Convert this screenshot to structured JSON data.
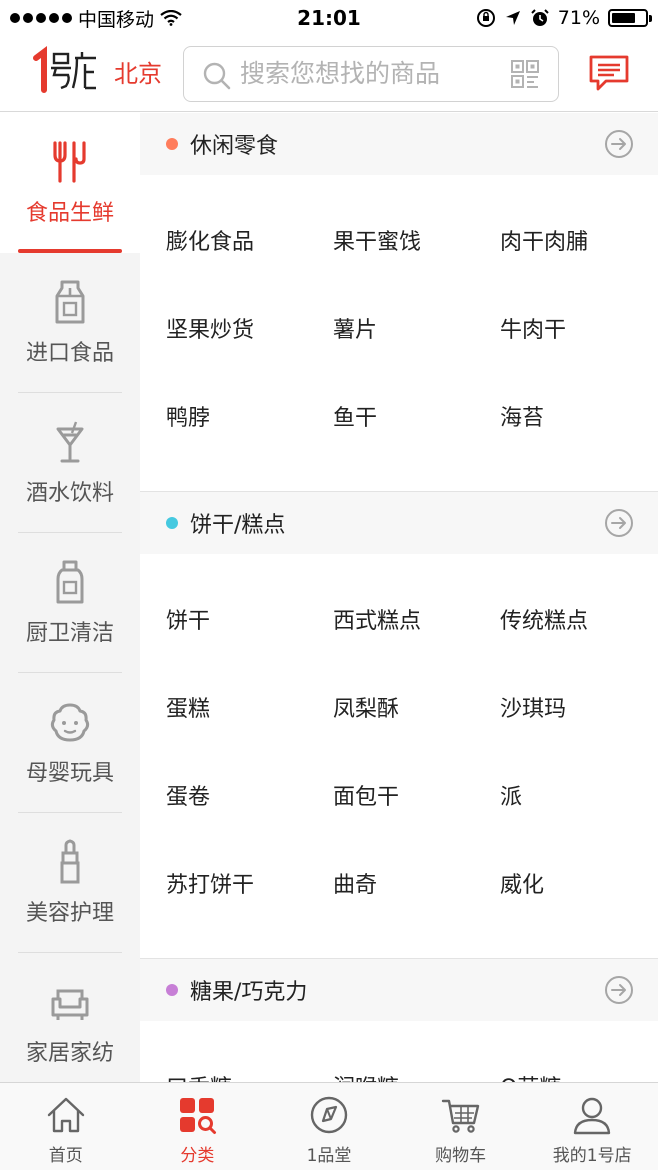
{
  "status_bar": {
    "carrier": "中国移动",
    "time": "21:01",
    "battery": "71%",
    "battery_level": 0.71
  },
  "header": {
    "logo_text": "1号店",
    "city": "北京",
    "search_placeholder": "搜索您想找的商品"
  },
  "sidebar": {
    "items": [
      {
        "label": "食品生鲜",
        "icon": "fork-knife-icon",
        "active": true
      },
      {
        "label": "进口食品",
        "icon": "milk-carton-icon",
        "active": false
      },
      {
        "label": "酒水饮料",
        "icon": "cocktail-glass-icon",
        "active": false
      },
      {
        "label": "厨卫清洁",
        "icon": "detergent-bottle-icon",
        "active": false
      },
      {
        "label": "母婴玩具",
        "icon": "baby-face-icon",
        "active": false
      },
      {
        "label": "美容护理",
        "icon": "lipstick-icon",
        "active": false
      },
      {
        "label": "家居家纺",
        "icon": "sofa-icon",
        "active": false
      }
    ]
  },
  "sections": [
    {
      "title": "休闲零食",
      "dot_color": "#ff7d5c",
      "items": [
        "膨化食品",
        "果干蜜饯",
        "肉干肉脯",
        "坚果炒货",
        "薯片",
        "牛肉干",
        "鸭脖",
        "鱼干",
        "海苔"
      ]
    },
    {
      "title": "饼干/糕点",
      "dot_color": "#45c9e0",
      "items": [
        "饼干",
        "西式糕点",
        "传统糕点",
        "蛋糕",
        "凤梨酥",
        "沙琪玛",
        "蛋卷",
        "面包干",
        "派",
        "苏打饼干",
        "曲奇",
        "威化"
      ]
    },
    {
      "title": "糖果/巧克力",
      "dot_color": "#c77fd6",
      "items": [
        "口香糖",
        "润喉糖",
        "Q萌糖"
      ]
    }
  ],
  "tabbar": {
    "items": [
      {
        "label": "首页",
        "icon": "home-icon",
        "active": false
      },
      {
        "label": "分类",
        "icon": "category-icon",
        "active": true
      },
      {
        "label": "1品堂",
        "icon": "compass-icon",
        "active": false
      },
      {
        "label": "购物车",
        "icon": "cart-icon",
        "active": false
      },
      {
        "label": "我的1号店",
        "icon": "user-icon",
        "active": false
      }
    ]
  },
  "colors": {
    "accent": "#e53a2e",
    "sidebar_bg": "#f4f4f4",
    "text_gray": "#555555"
  }
}
